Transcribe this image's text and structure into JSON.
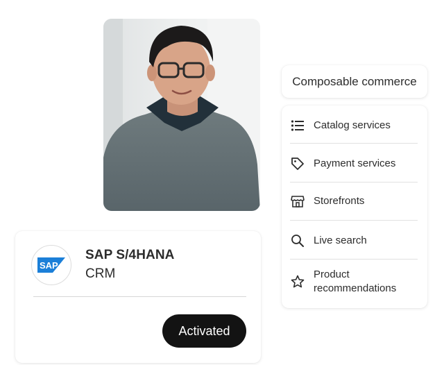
{
  "photo": {
    "subject": "person-portrait"
  },
  "sap_card": {
    "name": "SAP S/4HANA",
    "subtitle": "CRM",
    "logo_text": "SAP",
    "button_label": "Activated",
    "logo_color": "#1b7fd8"
  },
  "composable": {
    "title": "Composable commerce",
    "items": [
      {
        "label": "Catalog services",
        "icon": "list-icon"
      },
      {
        "label": "Payment services",
        "icon": "tag-icon"
      },
      {
        "label": "Storefronts",
        "icon": "storefront-icon"
      },
      {
        "label": "Live search",
        "icon": "search-icon"
      },
      {
        "label_line1": "Product",
        "label_line2": "recommendations",
        "icon": "star-icon"
      }
    ]
  },
  "colors": {
    "button_bg": "#131313",
    "text": "#2c2c2c",
    "divider": "#e1e1e1"
  }
}
